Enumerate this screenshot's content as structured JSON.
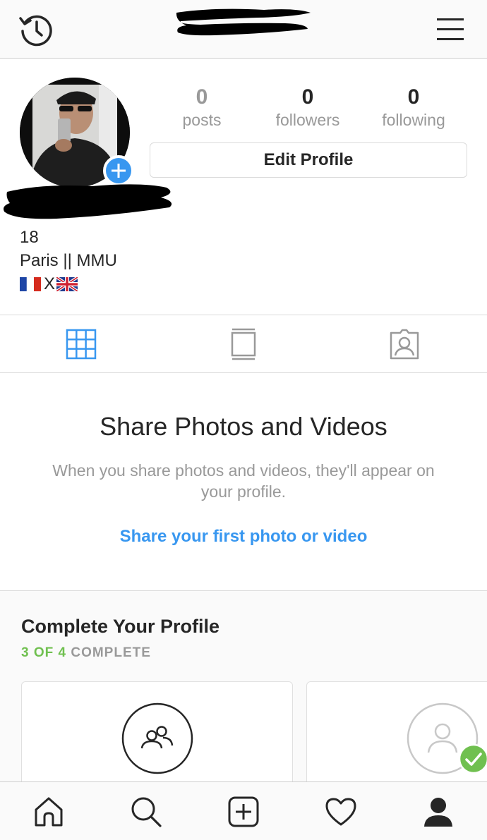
{
  "header": {
    "history_icon": "history-icon",
    "menu_icon": "hamburger-menu-icon"
  },
  "profile": {
    "stats": [
      {
        "value": "0",
        "label": "posts"
      },
      {
        "value": "0",
        "label": "followers"
      },
      {
        "value": "0",
        "label": "following"
      }
    ],
    "edit_button_label": "Edit Profile",
    "bio": {
      "line1": "18",
      "line2": "Paris || MMU",
      "line3_separator": "X"
    }
  },
  "tabs": [
    {
      "icon": "grid-icon",
      "active": true
    },
    {
      "icon": "feed-list-icon",
      "active": false
    },
    {
      "icon": "tagged-photos-icon",
      "active": false
    }
  ],
  "empty_state": {
    "title": "Share Photos and Videos",
    "description": "When you share photos and videos, they'll appear on your profile.",
    "link": "Share your first photo or video"
  },
  "complete_profile": {
    "title": "Complete Your Profile",
    "progress_highlight": "3 OF 4",
    "progress_suffix": "COMPLETE",
    "cards": [
      {
        "icon": "find-people-icon",
        "done": false
      },
      {
        "icon": "profile-photo-icon",
        "done": true
      }
    ]
  },
  "bottom_nav": [
    {
      "icon": "home-icon"
    },
    {
      "icon": "search-icon"
    },
    {
      "icon": "new-post-icon"
    },
    {
      "icon": "activity-heart-icon"
    },
    {
      "icon": "profile-icon",
      "active": true
    }
  ],
  "colors": {
    "accent_blue": "#3897f0",
    "complete_green": "#70c050",
    "muted_gray": "#999999",
    "text_dark": "#262626"
  }
}
